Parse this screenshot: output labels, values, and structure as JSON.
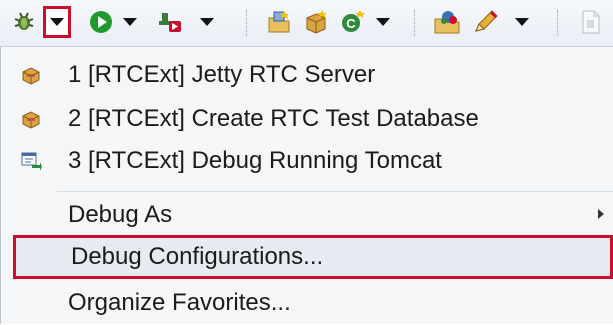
{
  "toolbar": {
    "buttons": [
      {
        "name": "debug",
        "icon": "bug-icon"
      },
      {
        "name": "debug-dropdown",
        "icon": "chevron-down-icon",
        "highlight_color": "#c8102e"
      },
      {
        "name": "run",
        "icon": "play-icon",
        "color": "#1f9b2e"
      },
      {
        "name": "run-dropdown",
        "icon": "chevron-down-icon"
      },
      {
        "name": "external-tools",
        "icon": "external-tools-icon"
      },
      {
        "name": "external-tools-dropdown",
        "icon": "chevron-down-icon"
      },
      {
        "name": "new-project",
        "icon": "new-project-icon"
      },
      {
        "name": "new-package",
        "icon": "new-package-icon"
      },
      {
        "name": "new-class",
        "icon": "new-class-icon",
        "color": "#2e8b3d"
      },
      {
        "name": "new-class-dropdown",
        "icon": "chevron-down-icon"
      },
      {
        "name": "open-perspective",
        "icon": "perspective-icon"
      },
      {
        "name": "annotate",
        "icon": "pen-icon"
      },
      {
        "name": "annotate-dropdown",
        "icon": "chevron-down-icon"
      },
      {
        "name": "disabled-tool",
        "icon": "document-icon"
      }
    ]
  },
  "menu": {
    "favorites": [
      {
        "label": "1 [RTCExt] Jetty RTC Server",
        "icon": "jar-icon"
      },
      {
        "label": "2 [RTCExt] Create RTC Test Database",
        "icon": "jar-icon"
      },
      {
        "label": "3 [RTCExt] Debug Running Tomcat",
        "icon": "remote-debug-icon"
      }
    ],
    "debug_as": {
      "label": "Debug As",
      "icon": "submenu-arrow-icon"
    },
    "debug_configurations": {
      "label": "Debug Configurations...",
      "highlight_color": "#c8102e"
    },
    "organize_favorites": {
      "label": "Organize Favorites..."
    }
  }
}
